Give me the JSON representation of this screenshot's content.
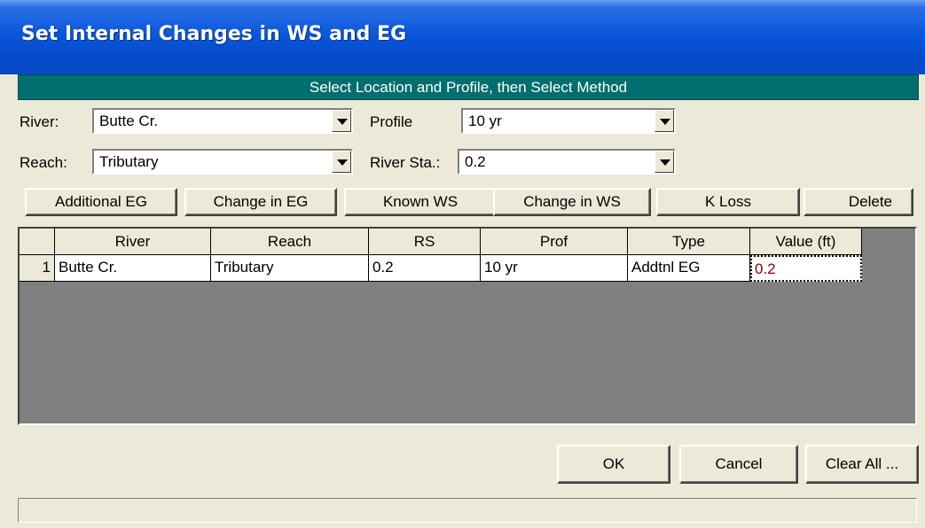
{
  "window": {
    "title": "Set Internal Changes in WS and EG"
  },
  "banner": "Select Location and Profile, then Select Method",
  "river": {
    "label": "River:",
    "value": "Butte Cr."
  },
  "reach": {
    "label": "Reach:",
    "value": "Tributary"
  },
  "profile": {
    "label": "Profile",
    "value": "10 yr"
  },
  "river_sta": {
    "label": "River Sta.:",
    "value": "0.2"
  },
  "methods": {
    "additional_eg": "Additional EG",
    "change_in_eg": "Change in EG",
    "known_ws": "Known WS",
    "change_in_ws": "Change in WS",
    "k_loss": "K Loss",
    "delete": "Delete"
  },
  "table": {
    "columns": [
      "River",
      "Reach",
      "RS",
      "Prof",
      "Type",
      "Value (ft)"
    ],
    "rows": [
      {
        "num": "1",
        "river": "Butte Cr.",
        "reach": "Tributary",
        "rs": "0.2",
        "prof": "10 yr",
        "type": "Addtnl EG",
        "value": "0.2"
      }
    ]
  },
  "footer": {
    "ok": "OK",
    "cancel": "Cancel",
    "clear_all": "Clear All ..."
  },
  "colors": {
    "banner": "#006e6e",
    "title_bar": "#0a58db",
    "value_text": "#8b0000"
  }
}
